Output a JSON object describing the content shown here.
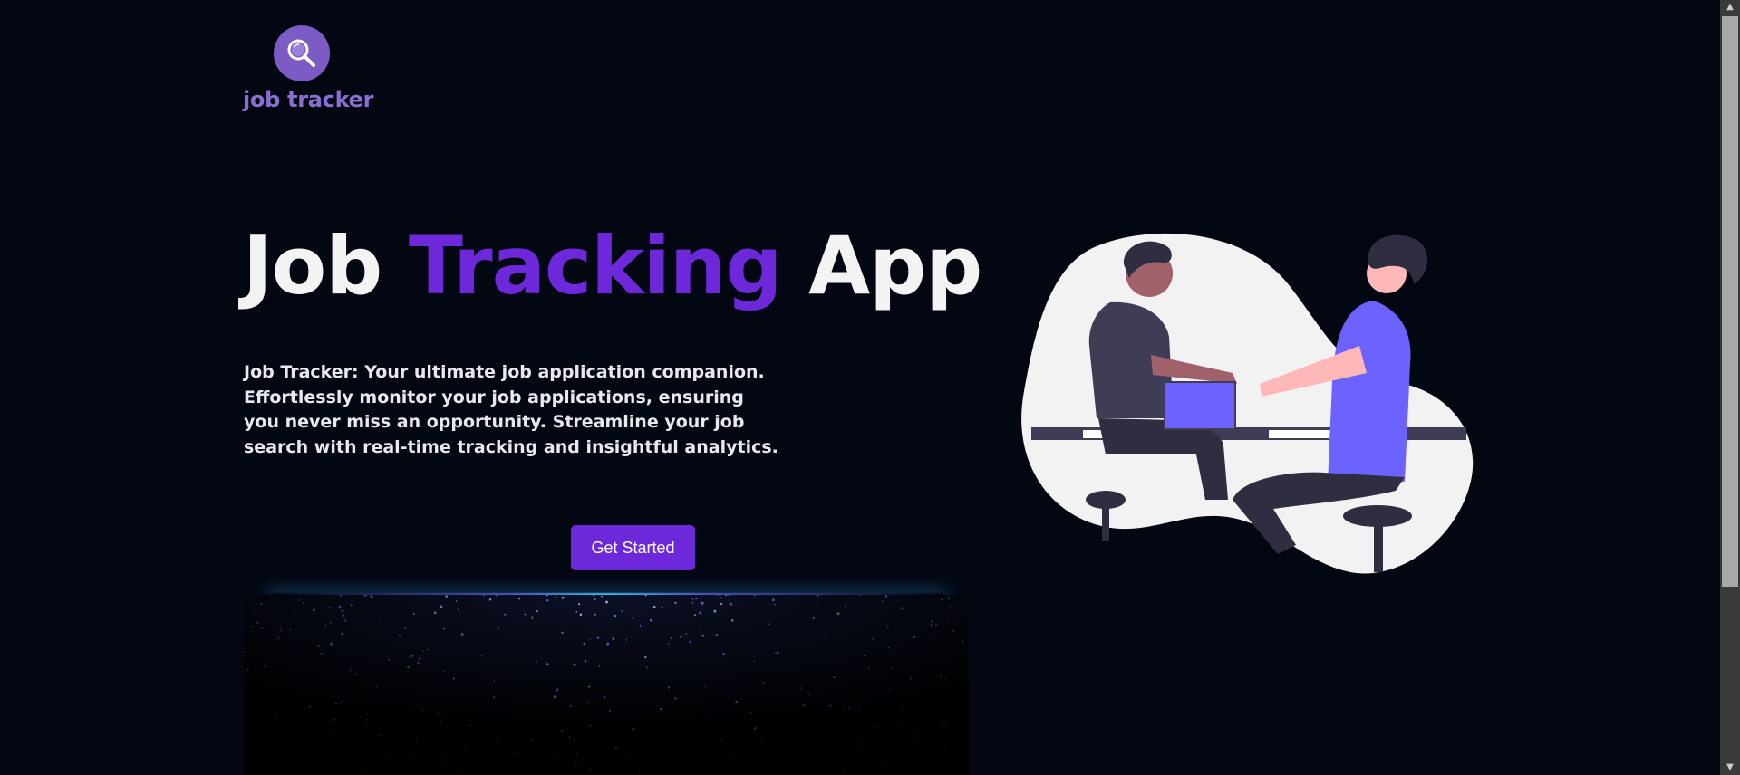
{
  "logo": {
    "text": "job tracker",
    "icon": "magnifier-icon",
    "color": "#7c5cc4"
  },
  "hero": {
    "title_part1": "Job ",
    "title_accent": "Tracking",
    "title_part2": " App",
    "accent_color": "#6d28d9",
    "description": "Job Tracker: Your ultimate job application companion. Effortlessly monitor your job applications, ensuring you never miss an opportunity. Streamline your job search with real-time tracking and insightful analytics."
  },
  "cta": {
    "label": "Get Started",
    "color": "#6d28d9"
  },
  "illustration": {
    "icon": "handshake-illustration",
    "shirt_color": "#6c63ff"
  },
  "scrollbar": {
    "up_icon": "arrow-up-icon",
    "down_icon": "arrow-down-icon"
  }
}
